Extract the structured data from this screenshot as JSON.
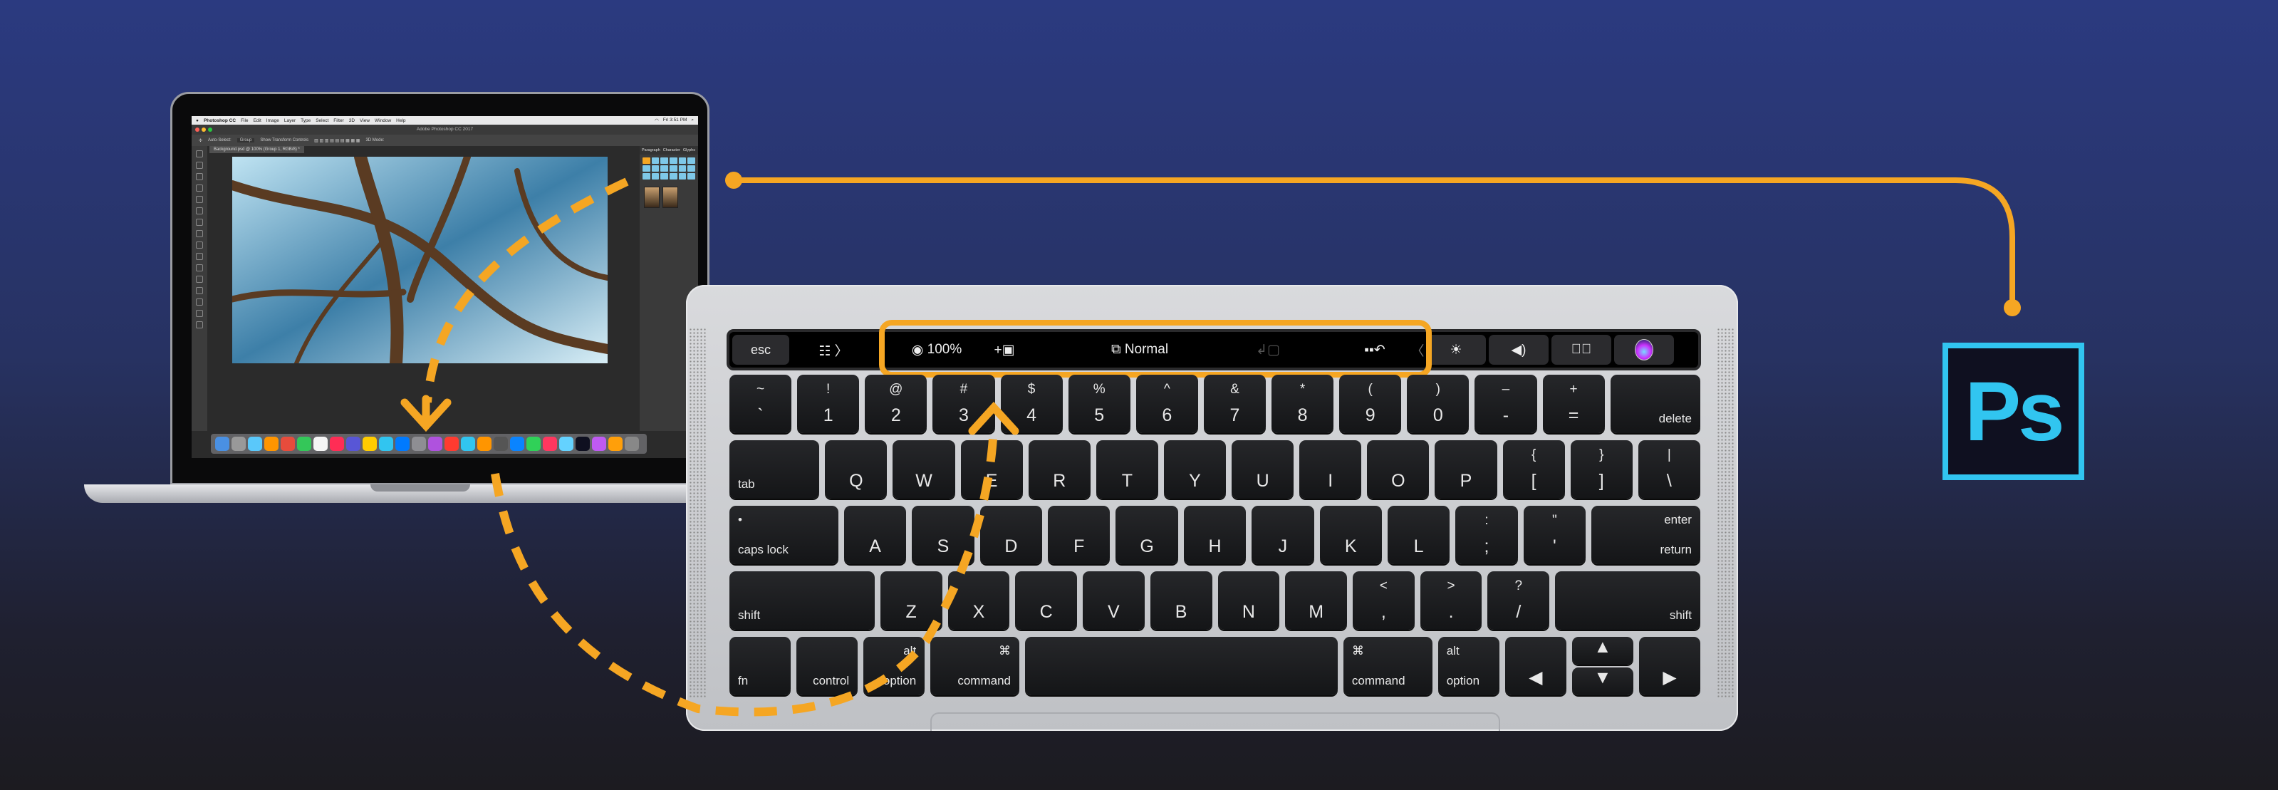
{
  "colors": {
    "accent": "#f5a623",
    "ps_blue": "#31c5f0",
    "ps_bg": "#0f1020"
  },
  "screen": {
    "menubar": {
      "items": [
        "Photoshop CC",
        "File",
        "Edit",
        "Image",
        "Layer",
        "Type",
        "Select",
        "Filter",
        "3D",
        "View",
        "Window",
        "Help"
      ],
      "clock": "Fri 3:51 PM"
    },
    "title": "Adobe Photoshop CC 2017",
    "options": {
      "auto_select": "Auto-Select:",
      "group": "Group",
      "transform": "Show Transform Controls",
      "mode": "3D Mode:"
    },
    "doc_tab": "Background.psd @ 100% (Group 1, RGB/8) *",
    "panel_tabs": [
      "Paragraph",
      "Character",
      "Glyphs"
    ]
  },
  "touchbar": {
    "esc": "esc",
    "zoom": "100%",
    "blend_mode": "Normal",
    "icons": [
      "sliders-icon",
      "eye-icon",
      "add-layer-icon",
      "blend-mode-icon",
      "transfer-icon",
      "undo-icon",
      "brightness-icon",
      "volume-icon",
      "mute-icon",
      "siri-icon"
    ]
  },
  "keyboard": {
    "rows": [
      [
        {
          "t": "~",
          "b": "`"
        },
        {
          "t": "!",
          "b": "1"
        },
        {
          "t": "@",
          "b": "2"
        },
        {
          "t": "#",
          "b": "3"
        },
        {
          "t": "$",
          "b": "4"
        },
        {
          "t": "%",
          "b": "5"
        },
        {
          "t": "^",
          "b": "6"
        },
        {
          "t": "&",
          "b": "7"
        },
        {
          "t": "*",
          "b": "8"
        },
        {
          "t": "(",
          "b": "9"
        },
        {
          "t": ")",
          "b": "0"
        },
        {
          "t": "–",
          "b": "-"
        },
        {
          "t": "+",
          "b": "="
        },
        {
          "t": "",
          "b": "delete",
          "w": 1.45,
          "c": "modr"
        }
      ],
      [
        {
          "t": "",
          "b": "tab",
          "w": 1.45,
          "c": "mod"
        },
        {
          "t": "",
          "b": "Q"
        },
        {
          "t": "",
          "b": "W"
        },
        {
          "t": "",
          "b": "E"
        },
        {
          "t": "",
          "b": "R"
        },
        {
          "t": "",
          "b": "T"
        },
        {
          "t": "",
          "b": "Y"
        },
        {
          "t": "",
          "b": "U"
        },
        {
          "t": "",
          "b": "I"
        },
        {
          "t": "",
          "b": "O"
        },
        {
          "t": "",
          "b": "P"
        },
        {
          "t": "{",
          "b": "["
        },
        {
          "t": "}",
          "b": "]"
        },
        {
          "t": "|",
          "b": "\\"
        }
      ],
      [
        {
          "t": "•",
          "b": "caps lock",
          "w": 1.75,
          "c": "mod"
        },
        {
          "t": "",
          "b": "A"
        },
        {
          "t": "",
          "b": "S"
        },
        {
          "t": "",
          "b": "D"
        },
        {
          "t": "",
          "b": "F"
        },
        {
          "t": "",
          "b": "G"
        },
        {
          "t": "",
          "b": "H"
        },
        {
          "t": "",
          "b": "J"
        },
        {
          "t": "",
          "b": "K"
        },
        {
          "t": "",
          "b": "L"
        },
        {
          "t": ":",
          "b": ";"
        },
        {
          "t": "\"",
          "b": "'"
        },
        {
          "t": "enter",
          "b": "return",
          "w": 1.75,
          "c": "modr"
        }
      ],
      [
        {
          "t": "",
          "b": "shift",
          "w": 2.35,
          "c": "mod"
        },
        {
          "t": "",
          "b": "Z"
        },
        {
          "t": "",
          "b": "X"
        },
        {
          "t": "",
          "b": "C"
        },
        {
          "t": "",
          "b": "V"
        },
        {
          "t": "",
          "b": "B"
        },
        {
          "t": "",
          "b": "N"
        },
        {
          "t": "",
          "b": "M"
        },
        {
          "t": "<",
          "b": ","
        },
        {
          "t": ">",
          "b": "."
        },
        {
          "t": "?",
          "b": "/"
        },
        {
          "t": "",
          "b": "shift",
          "w": 2.35,
          "c": "modr"
        }
      ],
      [
        {
          "t": "",
          "b": "fn",
          "c": "mod"
        },
        {
          "t": "",
          "b": "control",
          "c": "modr"
        },
        {
          "t": "alt",
          "b": "option",
          "c": "modr"
        },
        {
          "t": "⌘",
          "b": "command",
          "w": 1.45,
          "c": "modr"
        },
        {
          "t": "",
          "b": "",
          "w": 5.1
        },
        {
          "t": "⌘",
          "b": "command",
          "w": 1.45,
          "c": "mod"
        },
        {
          "t": "alt",
          "b": "option",
          "c": "mod"
        },
        {
          "t": "",
          "b": "◀"
        },
        {
          "stack": [
            {
              "t": "",
              "b": "▲"
            },
            {
              "t": "",
              "b": "▼"
            }
          ]
        },
        {
          "t": "",
          "b": "▶"
        }
      ]
    ]
  },
  "logo": {
    "text": "Ps"
  }
}
